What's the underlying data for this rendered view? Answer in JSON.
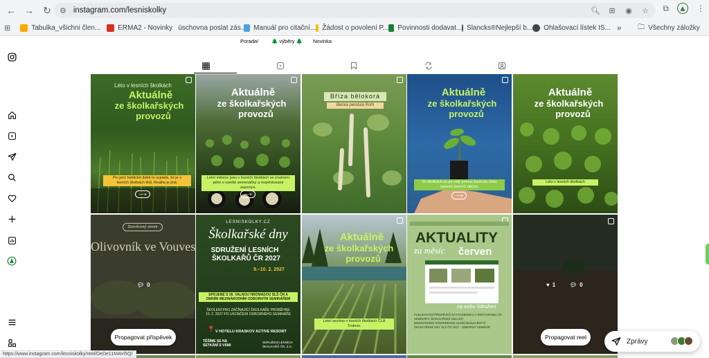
{
  "browser": {
    "url": "instagram.com/lesniskolky",
    "status_url": "https://www.instagram.com/lesniskolky/reel/DeDe11MAVi5Q/"
  },
  "bookmarks": [
    {
      "label": "Tabulka_všichni člen...",
      "color": "#f9ab00"
    },
    {
      "label": "ERMA2 - Novinky",
      "color": "#d93025"
    },
    {
      "label": "úschovna poslat zás...",
      "color": "#4285f4"
    },
    {
      "label": "Manuál pro citační...",
      "color": "#4aa3df"
    },
    {
      "label": "Žádost o povolení P...",
      "color": "#fbbc04"
    },
    {
      "label": "Povinnosti dodavat...",
      "color": "#1a7f37"
    },
    {
      "label": "Slancks®Nejlepší b...",
      "color": "#444444"
    },
    {
      "label": "Ohlašovací lístek IS...",
      "color": "#444444"
    }
  ],
  "bookmarks_more": "»",
  "bookmarks_folder": "Všechny záložky",
  "highlights": [
    {
      "label": "Porada!"
    },
    {
      "label": "🌲 výběry 🌲"
    },
    {
      "label": "Novinka"
    }
  ],
  "tiles": [
    {
      "lines": [
        "Léto v lesních školkách",
        "Aktuálně",
        "ze školkařských",
        "provozů"
      ],
      "caption": "Po jarní hektické době to vypadá, že je v lesních školkách klid. Realita je jiná.",
      "multi": true
    },
    {
      "lines": [
        "Aktuálně",
        "ze školkařských",
        "provozů"
      ],
      "caption": "Letní měsíce jsou v lesních školkách ve znamení péče o vzešlé semenáčky a rozpěstované sazenice.",
      "multi": true
    },
    {
      "lines": [
        "Bříza bělokorá",
        "Betula pendula Roth"
      ],
      "caption": "",
      "multi": true
    },
    {
      "lines": [
        "Aktuálně",
        "ze školkařských",
        "provozů"
      ],
      "caption": "Ve školkách se po celý provoz kontrola růstu sazenic lesních dřevin.",
      "multi": true
    },
    {
      "lines": [
        "Aktuálně",
        "ze školkařských",
        "provozů"
      ],
      "caption": "Léto v lesních školkách",
      "multi": false
    },
    {
      "lines": [
        "Zasvěcený strom",
        "Olivovník ve Vouves"
      ],
      "stat": "0",
      "multi": false
    },
    {
      "lines": [
        "LESNISKOLKY.CZ",
        "Školkařské dny",
        "SDRUŽENÍ LESNÍCH",
        "ŠKOLKAŘŮ ČR 2027",
        "9.–10. 2. 2027",
        "SPOJENÉ S 30. VALNOU HROMADOU SLŠ ČR A ZIMNÍM MEZINÁRODNÍM ODBORNÝM SEMINÁŘEM",
        "ŠKOLENÍ PRO ZAČÍNAJÍCÍ ŠKOLKAŘE PROBĚHNE 10. 2. 2027 PO UKONČENÍ ODBORNÉHO SEMINÁŘE",
        "V HOTELU KRASKOV ACTIVE RESORT",
        "TĚŠÍME SE NA SETKÁNÍ S VÁMI",
        "SDRUŽENÍ LESNÍCH ŠKOLKAŘŮ ČR, Z.S."
      ],
      "multi": false
    },
    {
      "lines": [
        "Aktuálně",
        "ze školkařských",
        "provozů"
      ],
      "caption": "Letní sezóna v lesních školkách ČLA Trutnov.",
      "multi": true
    },
    {
      "lines": [
        "AKTUALITY",
        "za měsíc",
        "červen",
        "na webu Sdružení",
        "PUBLIKOVÁNÍ PŘÍSPĚVKŮ NA FACEBOOKU A INSTAGRAMU ČR",
        "SEMINÁŘ K ŠKOLKAŘSKÉ OBLASTI",
        "MEZINÁRODNÍ KONFERENCE LESNÍ ŠKOLKAŘSTVÍ",
        "ŠKOLKAŘSKÉ DNY SLŠ ČR 2027 - ODBORNÝ SEMINÁŘ"
      ],
      "multi": true
    },
    {
      "lines": [],
      "likes": "1",
      "stat": "0",
      "multi": false
    }
  ],
  "promote_post": "Propagovat příspěvek",
  "promote_reel": "Propagovat reel",
  "messages_label": "Zprávy"
}
